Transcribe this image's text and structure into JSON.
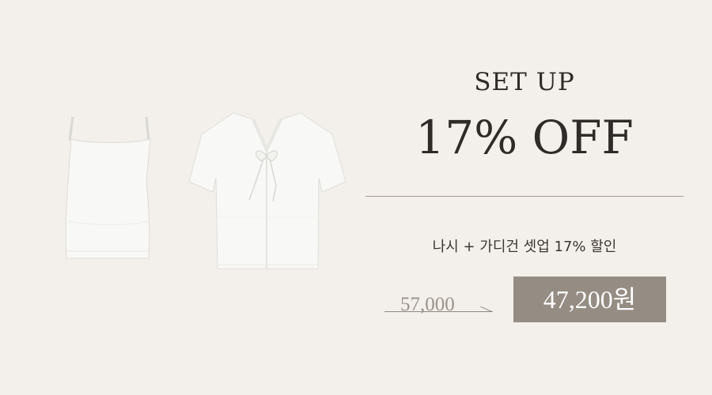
{
  "promo": {
    "eyebrow": "SET UP",
    "headline": "17% OFF",
    "subtitle": "나시 + 가디건 셋업 17% 할인",
    "original_price": "57,000",
    "sale_price": "47,200원"
  },
  "products": {
    "items": [
      {
        "name": "camisole-top",
        "color": "#f6f6f4"
      },
      {
        "name": "tie-front-cardigan",
        "color": "#f7f7f5"
      }
    ]
  },
  "colors": {
    "background": "#f3efea",
    "price_box": "#958d83",
    "text": "#2f2b28"
  }
}
